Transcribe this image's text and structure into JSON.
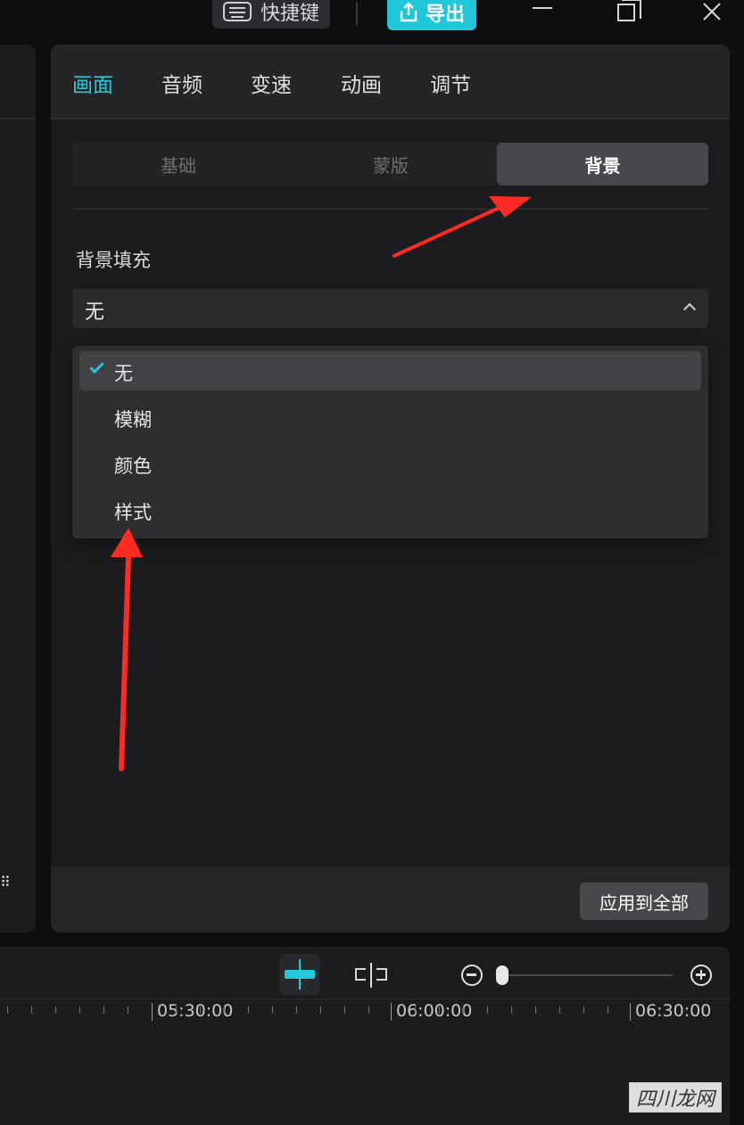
{
  "topbar": {
    "shortcut_label": "快捷键",
    "export_label": "导出"
  },
  "left_panel": {
    "glyph": "⠿"
  },
  "tabs": [
    {
      "label": "画面",
      "active": true
    },
    {
      "label": "音频",
      "active": false
    },
    {
      "label": "变速",
      "active": false
    },
    {
      "label": "动画",
      "active": false
    },
    {
      "label": "调节",
      "active": false
    }
  ],
  "segments": [
    {
      "label": "基础",
      "active": false
    },
    {
      "label": "蒙版",
      "active": false
    },
    {
      "label": "背景",
      "active": true
    }
  ],
  "background_fill": {
    "label": "背景填充",
    "value": "无",
    "options": [
      {
        "label": "无",
        "selected": true
      },
      {
        "label": "模糊",
        "selected": false
      },
      {
        "label": "颜色",
        "selected": false
      },
      {
        "label": "样式",
        "selected": false
      }
    ]
  },
  "footer": {
    "apply_all_label": "应用到全部"
  },
  "timeline": {
    "timecodes": [
      "05:30:00",
      "06:00:00",
      "06:30:00"
    ]
  },
  "colors": {
    "accent": "#24c8d8",
    "arrow": "#ff2a22"
  },
  "watermark": "四川龙网"
}
